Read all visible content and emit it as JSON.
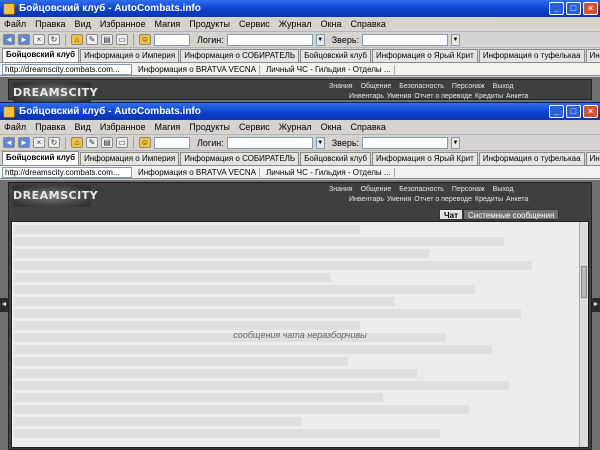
{
  "title": "Бойцовский клуб - AutoCombats.info",
  "menu": [
    "Файл",
    "Правка",
    "Вид",
    "Избранное",
    "Магия",
    "Продукты",
    "Сервис",
    "Журнал",
    "Окна",
    "Справка"
  ],
  "toolbar": {
    "login_label": "Логин:",
    "beast_label": "Зверь:"
  },
  "tabs": [
    "Бойцовский клуб",
    "Информация о Империя",
    "Информация о СОБИРАТЕЛЬ",
    "Бойцовский клуб",
    "Информация о Ярый Крит",
    "Информация о туфелькаа",
    "Информация о торка"
  ],
  "tabs2": [
    "Информация о Империя",
    "Информация о СОБИРАТЕЛЬ",
    "Бойцовский клуб",
    "Информация о Ярый Крит",
    "Информация о туфелькаа",
    "Информация о торка"
  ],
  "address": "http://dreamscity.combats.com...",
  "address_tabs": [
    "Информация о BRATVA VECNA",
    "Личный ЧС - Гильдия - Отделы ..."
  ],
  "game": {
    "logo": "DREAMSCITY",
    "nav_top": [
      "Знания",
      "Общение",
      "Безопасность",
      "Персонаж",
      "Выход"
    ],
    "nav_bottom": [
      "Инвентарь",
      "Умения",
      "Отчет о переводе",
      "Кредиты",
      "Анкета"
    ],
    "chat_tabs": [
      "Чат",
      "Системные сообщения"
    ],
    "chat_note": "сообщения чата неразборчивы"
  },
  "colors": {
    "titlebar": "#0a3fc7",
    "chrome": "#d6d3ce",
    "game_bg": "#3f3f3f"
  }
}
